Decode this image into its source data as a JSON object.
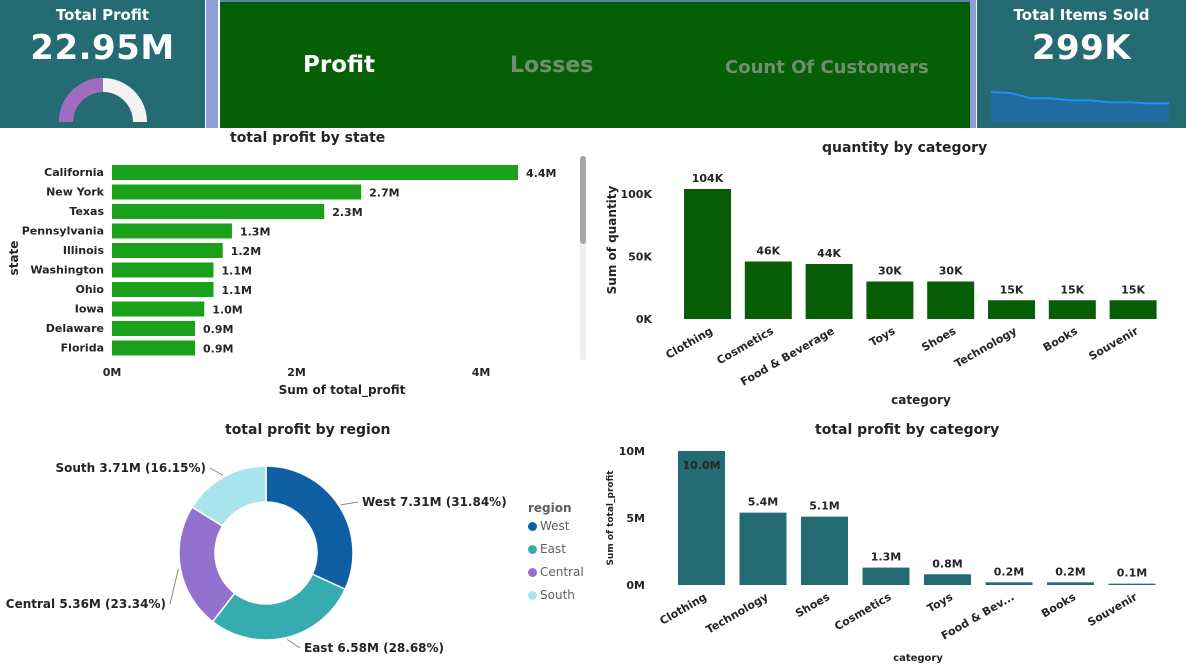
{
  "kpi_profit": {
    "title": "Total Profit",
    "value": "22.95M",
    "gauge_fraction": 0.5
  },
  "kpi_items": {
    "title": "Total Items Sold",
    "value": "299K",
    "spark": [
      29,
      28,
      23,
      23,
      21,
      21,
      19,
      19,
      18,
      18
    ]
  },
  "tabs": {
    "profit": "Profit",
    "losses": "Losses",
    "customers": "Count Of Customers"
  },
  "colors": {
    "kpi_bg": "#256b73",
    "tab_bg": "#065f06",
    "state_bar": "#19a119",
    "qty_bar": "#075e07",
    "cat_bar": "#256b73",
    "west": "#0e5fa3",
    "east": "#36acb0",
    "central": "#9271cf",
    "south": "#a8e4ee"
  },
  "chart_data": [
    {
      "type": "bar",
      "orientation": "horizontal",
      "title": "total profit by state",
      "xlabel": "Sum of total_profit",
      "ylabel": "state",
      "categories": [
        "California",
        "New York",
        "Texas",
        "Pennsylvania",
        "Illinois",
        "Washington",
        "Ohio",
        "Iowa",
        "Delaware",
        "Florida"
      ],
      "values": [
        4.4,
        2.7,
        2.3,
        1.3,
        1.2,
        1.1,
        1.1,
        1.0,
        0.9,
        0.9
      ],
      "labels": [
        "4.4M",
        "2.7M",
        "2.3M",
        "1.3M",
        "1.2M",
        "1.1M",
        "1.1M",
        "1.0M",
        "0.9M",
        "0.9M"
      ],
      "ticks": [
        "0M",
        "2M",
        "4M"
      ],
      "xlim": [
        0,
        4.4
      ]
    },
    {
      "type": "bar",
      "title": "quantity by category",
      "xlabel": "category",
      "ylabel": "Sum of quantity",
      "categories": [
        "Clothing",
        "Cosmetics",
        "Food & Beverage",
        "Toys",
        "Shoes",
        "Technology",
        "Books",
        "Souvenir"
      ],
      "values": [
        104,
        46,
        44,
        30,
        30,
        15,
        15,
        15
      ],
      "labels": [
        "104K",
        "46K",
        "44K",
        "30K",
        "30K",
        "15K",
        "15K",
        "15K"
      ],
      "ticks": [
        "0K",
        "50K",
        "100K"
      ],
      "ylim": [
        0,
        104
      ]
    },
    {
      "type": "pie",
      "title": "total profit by region",
      "legend_title": "region",
      "categories": [
        "West",
        "East",
        "Central",
        "South"
      ],
      "values": [
        31.84,
        28.68,
        23.34,
        16.15
      ],
      "labels": [
        "West 7.31M (31.84%)",
        "East 6.58M (28.68%)",
        "Central 5.36M (23.34%)",
        "South 3.71M (16.15%)"
      ]
    },
    {
      "type": "bar",
      "title": "total profit by category",
      "xlabel": "category",
      "ylabel": "Sum of total_profit",
      "categories": [
        "Clothing",
        "Technology",
        "Shoes",
        "Cosmetics",
        "Toys",
        "Food & Bev...",
        "Books",
        "Souvenir"
      ],
      "values": [
        10.0,
        5.4,
        5.1,
        1.3,
        0.8,
        0.2,
        0.2,
        0.1
      ],
      "labels": [
        "10.0M",
        "5.4M",
        "5.1M",
        "1.3M",
        "0.8M",
        "0.2M",
        "0.2M",
        "0.1M"
      ],
      "ticks": [
        "0M",
        "5M",
        "10M"
      ],
      "ylim": [
        0,
        10
      ]
    }
  ]
}
